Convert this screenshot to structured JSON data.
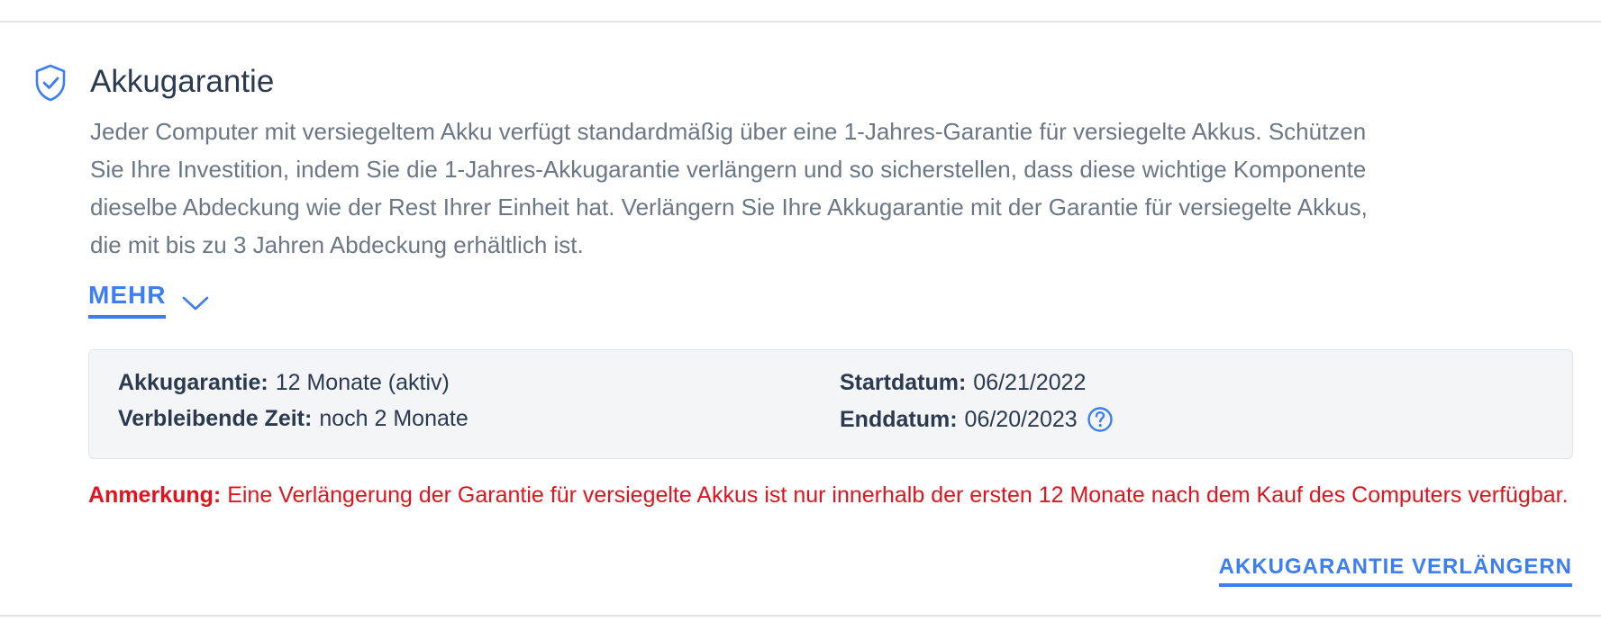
{
  "section": {
    "title": "Akkugarantie",
    "description": "Jeder Computer mit versiegeltem Akku verfügt standardmäßig über eine 1-Jahres-Garantie für versiegelte Akkus. Schützen Sie Ihre Investition, indem Sie die 1-Jahres-Akkugarantie verlängern und so sicherstellen, dass diese wichtige Komponente dieselbe Abdeckung wie der Rest Ihrer Einheit hat. Verlängern Sie Ihre Akkugarantie mit der Garantie für versiegelte Akkus, die mit bis zu 3 Jahren Abdeckung erhältlich ist.",
    "more_label": "MEHR",
    "icon": "shield-check-icon"
  },
  "details": {
    "warranty_label": "Akkugarantie:",
    "warranty_value": "12 Monate (aktiv)",
    "remaining_label": "Verbleibende Zeit:",
    "remaining_value": "noch 2 Monate",
    "start_label": "Startdatum:",
    "start_value": "06/21/2022",
    "end_label": "Enddatum:",
    "end_value": "06/20/2023",
    "help_icon": "question-circle-icon"
  },
  "note": {
    "label": "Anmerkung:",
    "text": "Eine Verlängerung der Garantie für versiegelte Akkus ist nur innerhalb der ersten 12 Monate nach dem Kauf des Computers verfügbar."
  },
  "actions": {
    "extend_label": "AKKUGARANTIE VERLÄNGERN"
  },
  "colors": {
    "accent": "#3d7ef0",
    "warning": "#e0141e",
    "text_dark": "#2b3a4f",
    "text_muted": "#6b7785"
  }
}
